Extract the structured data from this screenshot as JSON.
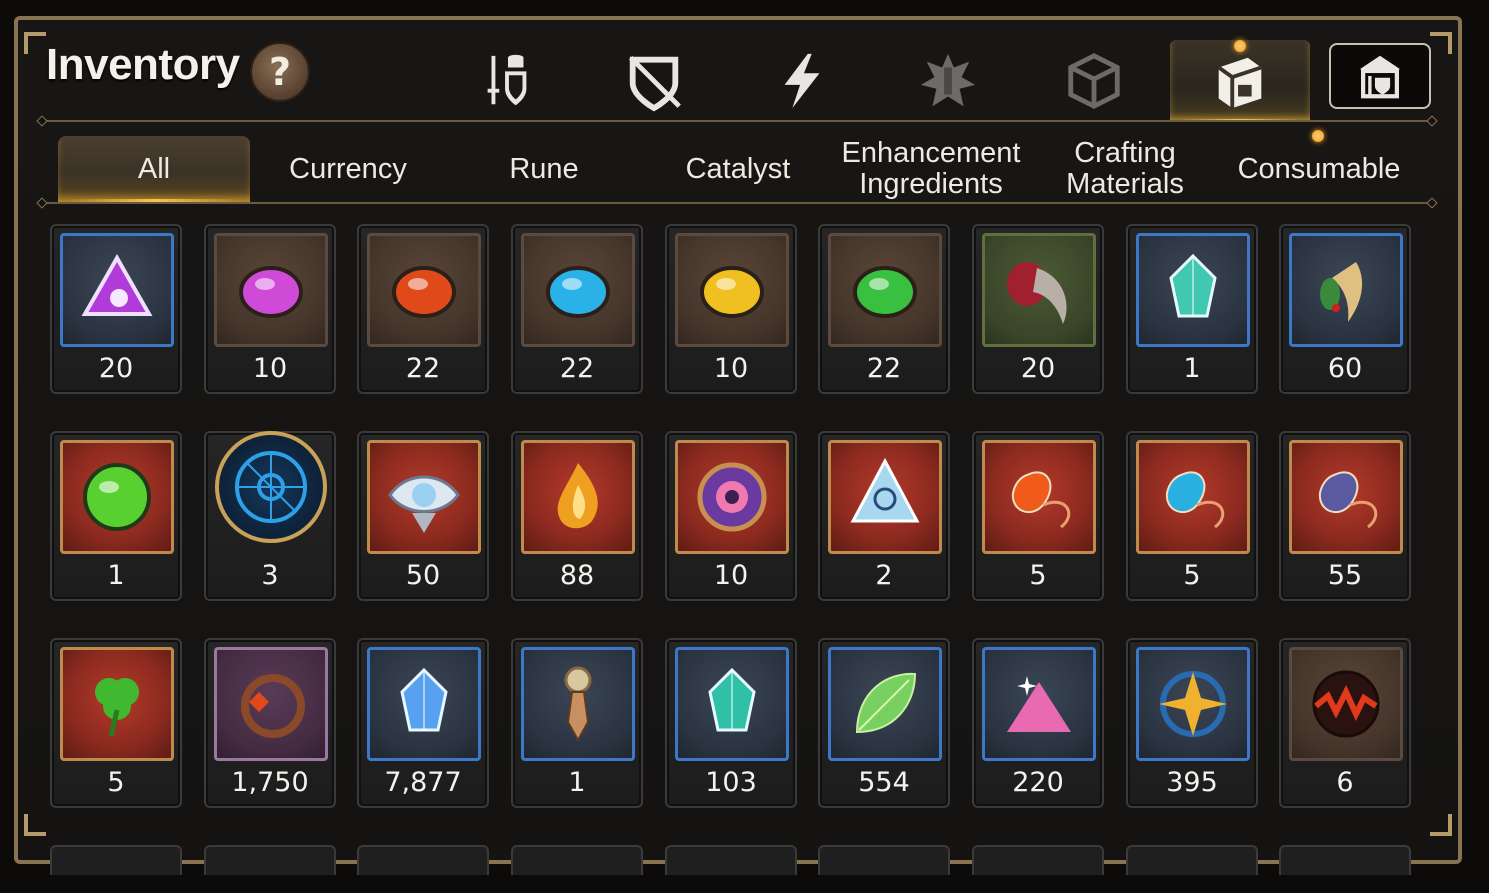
{
  "header": {
    "title": "Inventory",
    "help_label": "?"
  },
  "category_tabs": [
    {
      "icon": "sword-shield-icon",
      "active": false
    },
    {
      "icon": "broken-shield-icon",
      "active": false
    },
    {
      "icon": "lightning-icon",
      "active": false
    },
    {
      "icon": "emblem-icon",
      "active": false
    },
    {
      "icon": "cube-icon",
      "active": false
    },
    {
      "icon": "bag-icon",
      "active": true
    }
  ],
  "shop_button": {
    "icon": "shop-icon"
  },
  "sub_tabs": [
    {
      "label": "All",
      "active": true
    },
    {
      "label": "Currency",
      "active": false
    },
    {
      "label": "Rune",
      "active": false
    },
    {
      "label": "Catalyst",
      "active": false
    },
    {
      "label": "Enhancement\nIngredients",
      "active": false
    },
    {
      "label": "Crafting\nMaterials",
      "active": false
    },
    {
      "label": "Consumable",
      "active": false
    }
  ],
  "items": [
    {
      "icon": "purple-crescent-rune-icon",
      "count": "20",
      "frame": "blue",
      "color": "#b13bd8"
    },
    {
      "icon": "magenta-moon-rune-icon",
      "count": "10",
      "frame": "brown",
      "color": "#d04ad8"
    },
    {
      "icon": "orange-rune-icon",
      "count": "22",
      "frame": "brown",
      "color": "#e04a1a"
    },
    {
      "icon": "cyan-snowflake-rune-icon",
      "count": "22",
      "frame": "brown",
      "color": "#2ab2e8"
    },
    {
      "icon": "yellow-rune-icon",
      "count": "10",
      "frame": "brown",
      "color": "#f0c020"
    },
    {
      "icon": "green-rune-icon",
      "count": "22",
      "frame": "brown",
      "color": "#3ac040"
    },
    {
      "icon": "claw-icon",
      "count": "20",
      "frame": "green",
      "color": "#a02030"
    },
    {
      "icon": "teal-gem-icon",
      "count": "1",
      "frame": "blue",
      "color": "#40c8b0"
    },
    {
      "icon": "herb-root-icon",
      "count": "60",
      "frame": "blue",
      "color": "#e0c080"
    },
    {
      "icon": "green-potion-icon",
      "count": "1",
      "frame": "red",
      "color": "#58d030"
    },
    {
      "icon": "blue-seal-icon",
      "count": "3",
      "frame": "round",
      "color": "#2ea0e8"
    },
    {
      "icon": "eye-emblem-icon",
      "count": "50",
      "frame": "red",
      "color": "#9ad0f0"
    },
    {
      "icon": "amber-crystal-icon",
      "count": "88",
      "frame": "red",
      "color": "#f0a020"
    },
    {
      "icon": "purple-disc-icon",
      "count": "10",
      "frame": "red",
      "color": "#6a3aa0"
    },
    {
      "icon": "triangle-crystal-icon",
      "count": "2",
      "frame": "red",
      "color": "#a8d8f0"
    },
    {
      "icon": "fire-charm-icon",
      "count": "5",
      "frame": "red",
      "color": "#f05a1a"
    },
    {
      "icon": "water-charm-icon",
      "count": "5",
      "frame": "red",
      "color": "#2ab0e0"
    },
    {
      "icon": "wind-charm-icon",
      "count": "55",
      "frame": "red",
      "color": "#5a5aa0"
    },
    {
      "icon": "clover-charm-icon",
      "count": "5",
      "frame": "red",
      "color": "#40b830"
    },
    {
      "icon": "flower-ring-icon",
      "count": "1,750",
      "frame": "purple",
      "color": "#e04a1a"
    },
    {
      "icon": "blue-crystal-icon",
      "count": "7,877",
      "frame": "blue",
      "color": "#58a0f0"
    },
    {
      "icon": "pendulum-icon",
      "count": "1",
      "frame": "blue",
      "color": "#c89060"
    },
    {
      "icon": "teal-prism-icon",
      "count": "103",
      "frame": "blue",
      "color": "#30c0a8"
    },
    {
      "icon": "leaf-icon",
      "count": "554",
      "frame": "blue",
      "color": "#78d060"
    },
    {
      "icon": "pink-dust-icon",
      "count": "220",
      "frame": "blue",
      "color": "#e86ab0"
    },
    {
      "icon": "star-charm-icon",
      "count": "395",
      "frame": "blue",
      "color": "#f0b030"
    },
    {
      "icon": "lava-orb-icon",
      "count": "6",
      "frame": "brown",
      "color": "#e03a1a"
    }
  ]
}
